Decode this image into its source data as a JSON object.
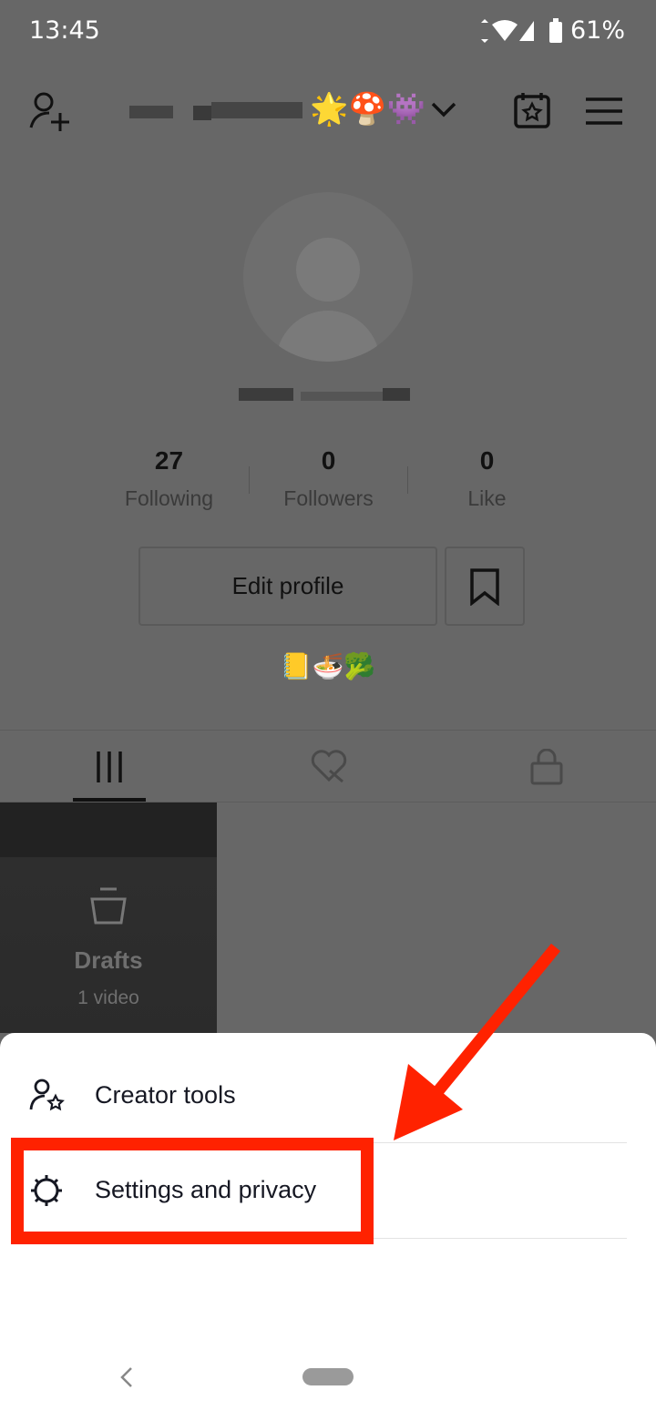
{
  "status_bar": {
    "time": "13:45",
    "battery": "61%"
  },
  "header": {
    "username_emojis": "🌟🍄👾"
  },
  "profile": {
    "stats": [
      {
        "value": "27",
        "label": "Following"
      },
      {
        "value": "0",
        "label": "Followers"
      },
      {
        "value": "0",
        "label": "Like"
      }
    ],
    "edit_profile_label": "Edit profile",
    "bio": "📒🍜🥦"
  },
  "drafts": {
    "title": "Drafts",
    "count": "1 video"
  },
  "sheet": {
    "items": [
      {
        "label": "Creator tools",
        "icon": "creator-tools-icon"
      },
      {
        "label": "Settings and privacy",
        "icon": "gear-icon"
      }
    ]
  },
  "annotation": {
    "color": "#ff2200"
  }
}
